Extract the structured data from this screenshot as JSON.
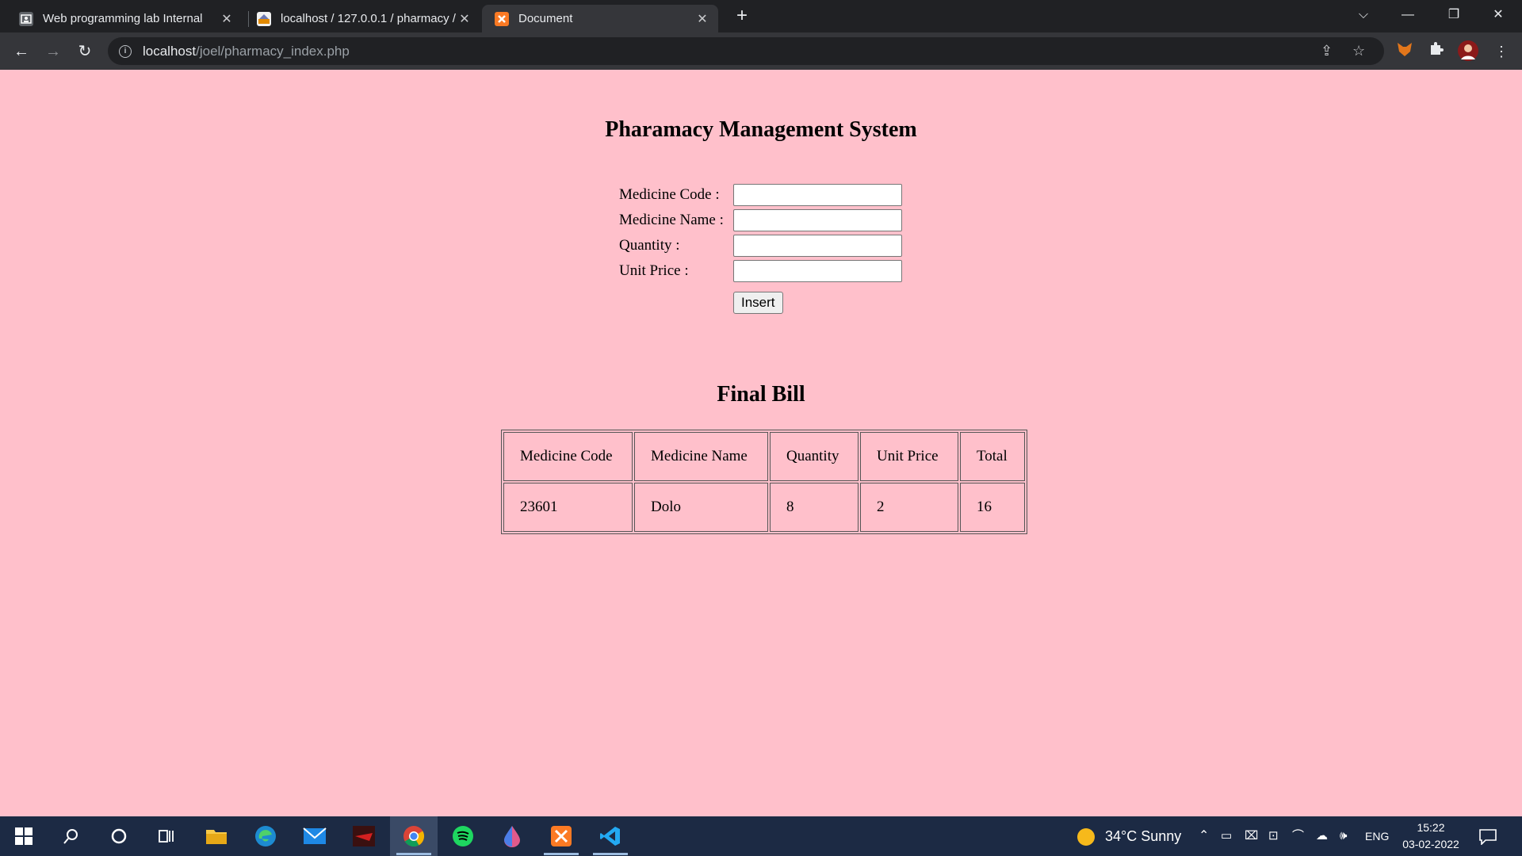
{
  "browser": {
    "tabs": [
      {
        "title": "Web programming lab Internal",
        "active": false
      },
      {
        "title": "localhost / 127.0.0.1 / pharmacy /",
        "active": false
      },
      {
        "title": "Document",
        "active": true
      }
    ],
    "url_host": "localhost",
    "url_path": "/joel/pharmacy_index.php"
  },
  "page": {
    "title": "Pharamacy Management System",
    "form": {
      "code_label": "Medicine Code :",
      "name_label": "Medicine Name :",
      "quantity_label": "Quantity :",
      "price_label": "Unit Price :",
      "code_value": "",
      "name_value": "",
      "quantity_value": "",
      "price_value": "",
      "insert_label": "Insert"
    },
    "bill_title": "Final Bill",
    "table": {
      "headers": [
        "Medicine Code",
        "Medicine Name",
        "Quantity",
        "Unit Price",
        "Total"
      ],
      "rows": [
        [
          "23601",
          "Dolo",
          "8",
          "2",
          "16"
        ]
      ]
    }
  },
  "taskbar": {
    "weather": "34°C  Sunny",
    "language": "ENG",
    "time": "15:22",
    "date": "03-02-2022"
  },
  "colors": {
    "page_bg": "#ffc0cb",
    "chrome_dark": "#202124",
    "chrome_toolbar": "#35363a",
    "taskbar": "#1c2a44"
  }
}
